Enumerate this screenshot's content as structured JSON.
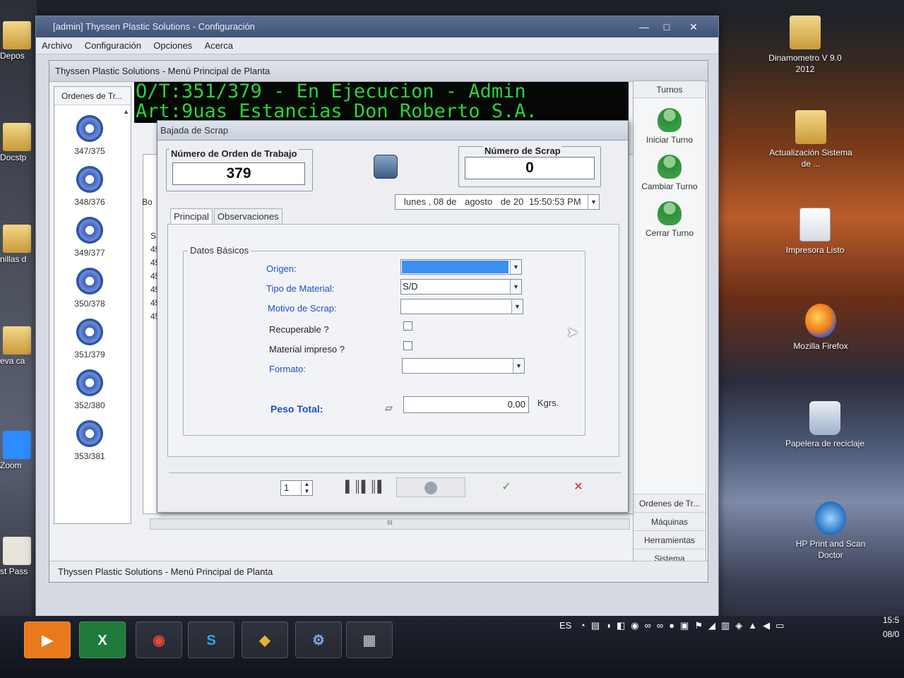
{
  "desktop": {
    "left_items": [
      "Depos",
      "Docstp",
      "nillas d",
      "eva ca",
      "Zoom",
      "st Pass"
    ],
    "right_items": [
      {
        "label": "Dinamometro V 9.0 2012",
        "icon": "folder-icon"
      },
      {
        "label": "Actualización Sistema de ...",
        "icon": "folder-icon"
      },
      {
        "label": "Impresora Listo",
        "icon": "word-doc-icon"
      },
      {
        "label": "Mozilla Firefox",
        "icon": "firefox-icon"
      },
      {
        "label": "Papelera de reciclaje",
        "icon": "recycle-bin-icon"
      },
      {
        "label": "HP Print and Scan Doctor",
        "icon": "hp-icon"
      }
    ]
  },
  "window": {
    "title": "[admin] Thyssen Plastic Solutions - Configuración",
    "menu": [
      "Archivo",
      "Configuración",
      "Opciones",
      "Acerca"
    ],
    "controls": {
      "minimize": "—",
      "maximize": "□",
      "close": "✕"
    }
  },
  "inner": {
    "title": "Thyssen Plastic Solutions - Menú Principal de Planta",
    "orders_header": "Ordenes de Tr...",
    "orders": [
      "347/375",
      "348/376",
      "349/377",
      "350/378",
      "351/379",
      "352/380",
      "353/381"
    ],
    "marquee_line1": "O/T:351/379 - En Ejecucion - Admin",
    "marquee_line2": "Art:9uas Estancias Don Roberto S.A.",
    "bg_label": "Bo",
    "bg_col": "S",
    "bg_rows": [
      "45",
      "45",
      "45",
      "45",
      "45",
      "45"
    ],
    "status": "Thyssen Plastic Solutions - Menú Principal de Planta",
    "hscroll_label": "III"
  },
  "turnos": {
    "header": "Turnos",
    "buttons": [
      "Iniciar Turno",
      "Cambiar Turno",
      "Cerrar Turno"
    ],
    "nav": [
      "Ordenes de Tr...",
      "Máquinas",
      "Herramientas",
      "Sistema"
    ]
  },
  "dialog": {
    "title": "Bajada de Scrap",
    "orden_label": "Número de Orden de Trabajo",
    "orden_value": "379",
    "scrap_label": "Número de Scrap",
    "scrap_value": "0",
    "date": {
      "weekday": "lunes",
      "day": ", 08 de",
      "month": "agosto",
      "year": "de 20",
      "time": "15:50:53 PM"
    },
    "tabs": [
      "Principal",
      "Observaciones"
    ],
    "group_title": "Datos Básicos",
    "fields": {
      "origen": "Origen:",
      "tipo_material": "Tipo de Material:",
      "tipo_material_value": "S/D",
      "motivo": "Motivo de Scrap:",
      "recuperable": "Recuperable ?",
      "material_impreso": "Material impreso ?",
      "formato": "Formato:",
      "peso_total": "Peso Total:",
      "peso_value": "0.00",
      "peso_unit": "Kgrs."
    },
    "footer": {
      "page": "1",
      "barcode": "▌║▌║▌",
      "confirm": "✓",
      "cancel": "✕"
    }
  },
  "taskbar": {
    "apps": [
      {
        "name": "media-player-icon",
        "glyph": "▶"
      },
      {
        "name": "excel-icon",
        "glyph": "X"
      },
      {
        "name": "chrome-icon",
        "glyph": "◉"
      },
      {
        "name": "skype-icon",
        "glyph": "S"
      },
      {
        "name": "app-gold-icon",
        "glyph": "◆"
      },
      {
        "name": "gear-app-icon",
        "glyph": "⚙"
      },
      {
        "name": "app-gray-icon",
        "glyph": "▦"
      }
    ],
    "language": "ES",
    "clock_time": "15:5",
    "clock_date": "08/0"
  }
}
